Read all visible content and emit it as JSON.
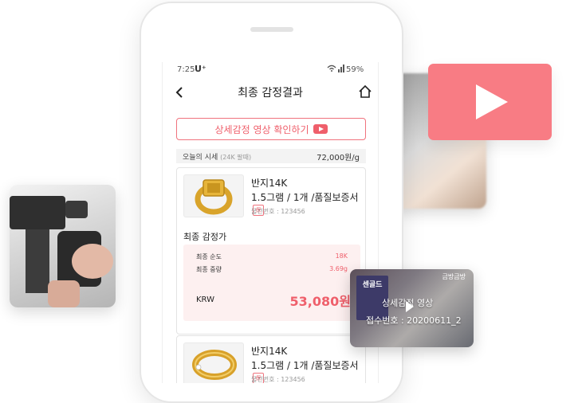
{
  "status": {
    "time": "7:25",
    "carrier": "U⁺",
    "battery": "59%"
  },
  "header": {
    "title": "최종 감정결과"
  },
  "video_button": {
    "label": "상세감정 영상 확인하기"
  },
  "gold_price": {
    "label": "오늘의 시세",
    "sub": "(24K 팔때)",
    "value": "72,000원/g"
  },
  "items": [
    {
      "name": "반지14K",
      "qty": "1.5그램 / 1개 /품질보증서",
      "badge": "保",
      "number": "물건번호 : 123456"
    },
    {
      "name": "반지14K",
      "qty": "1.5그램 / 1개 /품질보증서",
      "badge": "保",
      "number": "물건번호 : 123456"
    }
  ],
  "final": {
    "title": "최종 감정가",
    "purity_label": "최종 순도",
    "purity_value": "18K",
    "weight_label": "최종 중량",
    "weight_value": "3.69g",
    "currency": "KRW",
    "total": "53,080원"
  },
  "video_card": {
    "brand": "금방금방",
    "sign_text": "센골드",
    "title": "상세감정 영상",
    "receipt": "접수번호 : 20200611_2"
  },
  "colors": {
    "accent": "#ef5f6b",
    "play_red": "#f87c84"
  }
}
